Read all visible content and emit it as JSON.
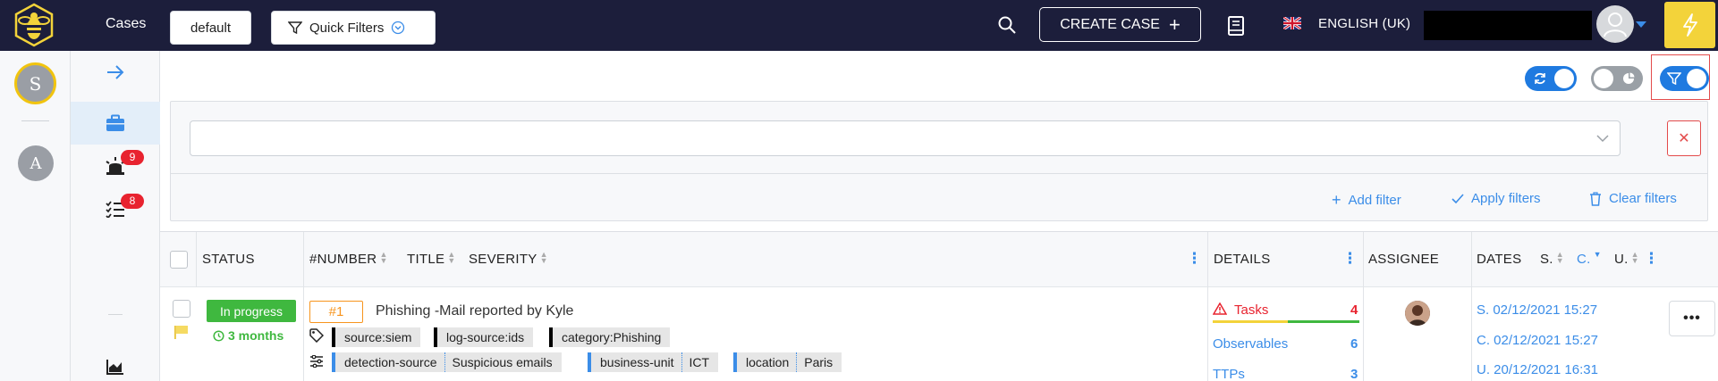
{
  "topbar": {
    "title": "Cases",
    "create_case_label": "CREATE CASE",
    "language": "ENGLISH (UK)"
  },
  "rail": {
    "orgs": [
      "S",
      "A"
    ]
  },
  "nav": {
    "alerts_badge": "9",
    "tasks_badge": "8"
  },
  "toolbar": {
    "preset_label": "default",
    "quick_filters_label": "Quick Filters"
  },
  "filters": {
    "add_filter": "Add filter",
    "apply_filters": "Apply filters",
    "clear_filters": "Clear filters"
  },
  "table": {
    "headers": {
      "status": "STATUS",
      "number": "#NUMBER",
      "title": "TITLE",
      "severity": "SEVERITY",
      "details": "DETAILS",
      "assignee": "ASSIGNEE",
      "dates": "DATES",
      "dates_s": "S.",
      "dates_c": "C.",
      "dates_u": "U."
    },
    "rows": [
      {
        "status": "In progress",
        "duration": "3 months",
        "number": "#1",
        "title": "Phishing -Mail reported by Kyle",
        "tags": [
          "source:siem",
          "log-source:ids",
          "category:Phishing"
        ],
        "custom_fields": [
          {
            "name": "detection-source",
            "value": "Suspicious emails"
          },
          {
            "name": "business-unit",
            "value": "ICT"
          },
          {
            "name": "location",
            "value": "Paris"
          }
        ],
        "details": {
          "tasks_label": "Tasks",
          "tasks_count": "4",
          "observables_label": "Observables",
          "observables_count": "6",
          "ttps_label": "TTPs",
          "ttps_count": "3"
        },
        "dates": {
          "start": "S. 02/12/2021 15:27",
          "created": "C. 02/12/2021 15:27",
          "updated": "U. 20/12/2021 16:31"
        }
      }
    ]
  },
  "colors": {
    "topbar_bg": "#1c1e3b",
    "accent": "#3b8de8",
    "status_green": "#3fb83f",
    "severity_orange": "#f7941d",
    "alert_red": "#e8232f",
    "bolt_yellow": "#f3d33a"
  }
}
